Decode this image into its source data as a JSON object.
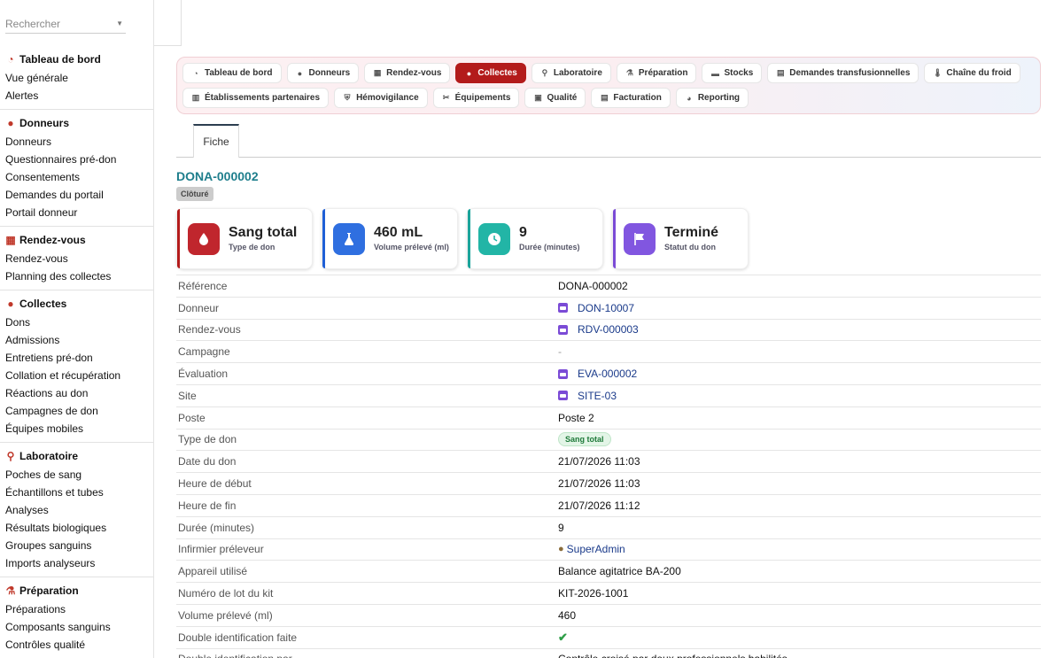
{
  "search": {
    "placeholder": "Rechercher"
  },
  "sidebar": {
    "sections": [
      {
        "title": "Tableau de bord",
        "icon": "gauge-icon",
        "items": [
          "Vue générale",
          "Alertes"
        ]
      },
      {
        "title": "Donneurs",
        "icon": "user-icon",
        "items": [
          "Donneurs",
          "Questionnaires pré-don",
          "Consentements",
          "Demandes du portail",
          "Portail donneur"
        ]
      },
      {
        "title": "Rendez-vous",
        "icon": "calendar-icon",
        "items": [
          "Rendez-vous",
          "Planning des collectes"
        ]
      },
      {
        "title": "Collectes",
        "icon": "drop-icon",
        "items": [
          "Dons",
          "Admissions",
          "Entretiens pré-don",
          "Collation et récupération",
          "Réactions au don",
          "Campagnes de don",
          "Équipes mobiles"
        ]
      },
      {
        "title": "Laboratoire",
        "icon": "microscope-icon",
        "items": [
          "Poches de sang",
          "Échantillons et tubes",
          "Analyses",
          "Résultats biologiques",
          "Groupes sanguins",
          "Imports analyseurs"
        ]
      },
      {
        "title": "Préparation",
        "icon": "flask-icon",
        "items": [
          "Préparations",
          "Composants sanguins",
          "Contrôles qualité"
        ]
      }
    ]
  },
  "modules": {
    "row1": [
      {
        "label": "Tableau de bord",
        "icon": "gauge-icon"
      },
      {
        "label": "Donneurs",
        "icon": "user-icon"
      },
      {
        "label": "Rendez-vous",
        "icon": "calendar-icon"
      },
      {
        "label": "Collectes",
        "icon": "drop-icon",
        "active": true
      },
      {
        "label": "Laboratoire",
        "icon": "microscope-icon"
      },
      {
        "label": "Préparation",
        "icon": "flask-icon"
      },
      {
        "label": "Stocks",
        "icon": "warehouse-icon"
      },
      {
        "label": "Demandes transfusionnelles",
        "icon": "file-icon"
      },
      {
        "label": "Chaîne du froid",
        "icon": "thermometer-icon"
      }
    ],
    "row2": [
      {
        "label": "Établissements partenaires",
        "icon": "building-icon"
      },
      {
        "label": "Hémovigilance",
        "icon": "shield-icon"
      },
      {
        "label": "Équipements",
        "icon": "tools-icon"
      },
      {
        "label": "Qualité",
        "icon": "clipboard-icon"
      },
      {
        "label": "Facturation",
        "icon": "invoice-icon"
      },
      {
        "label": "Reporting",
        "icon": "chart-pie-icon"
      }
    ]
  },
  "tab": {
    "label": "Fiche"
  },
  "record": {
    "title": "DONA-000002",
    "status_badge": "Clôturé"
  },
  "cards": [
    {
      "value": "Sang total",
      "label": "Type de don",
      "icon": "drop-icon"
    },
    {
      "value": "460 mL",
      "label": "Volume prélevé (ml)",
      "icon": "flask-icon"
    },
    {
      "value": "9",
      "label": "Durée (minutes)",
      "icon": "clock-icon"
    },
    {
      "value": "Terminé",
      "label": "Statut du don",
      "icon": "flag-icon"
    }
  ],
  "fields": [
    {
      "label": "Référence",
      "value": "DONA-000002",
      "kind": "text"
    },
    {
      "label": "Donneur",
      "value": "DON-10007",
      "kind": "link"
    },
    {
      "label": "Rendez-vous",
      "value": "RDV-000003",
      "kind": "link"
    },
    {
      "label": "Campagne",
      "value": "-",
      "kind": "muted"
    },
    {
      "label": "Évaluation",
      "value": "EVA-000002",
      "kind": "link"
    },
    {
      "label": "Site",
      "value": "SITE-03",
      "kind": "link"
    },
    {
      "label": "Poste",
      "value": "Poste 2",
      "kind": "text"
    },
    {
      "label": "Type de don",
      "value": "Sang total",
      "kind": "pill"
    },
    {
      "label": "Date du don",
      "value": "21/07/2026 11:03",
      "kind": "text"
    },
    {
      "label": "Heure de début",
      "value": "21/07/2026 11:03",
      "kind": "text"
    },
    {
      "label": "Heure de fin",
      "value": "21/07/2026 11:12",
      "kind": "text"
    },
    {
      "label": "Durée (minutes)",
      "value": "9",
      "kind": "text"
    },
    {
      "label": "Infirmier préleveur",
      "value": "SuperAdmin",
      "kind": "user"
    },
    {
      "label": "Appareil utilisé",
      "value": "Balance agitatrice BA-200",
      "kind": "text"
    },
    {
      "label": "Numéro de lot du kit",
      "value": "KIT-2026-1001",
      "kind": "text"
    },
    {
      "label": "Volume prélevé (ml)",
      "value": "460",
      "kind": "text"
    },
    {
      "label": "Double identification faite",
      "value": "",
      "kind": "check"
    },
    {
      "label": "Double identification par",
      "value": "Contrôle croisé par deux professionnels habilités",
      "kind": "text"
    }
  ]
}
